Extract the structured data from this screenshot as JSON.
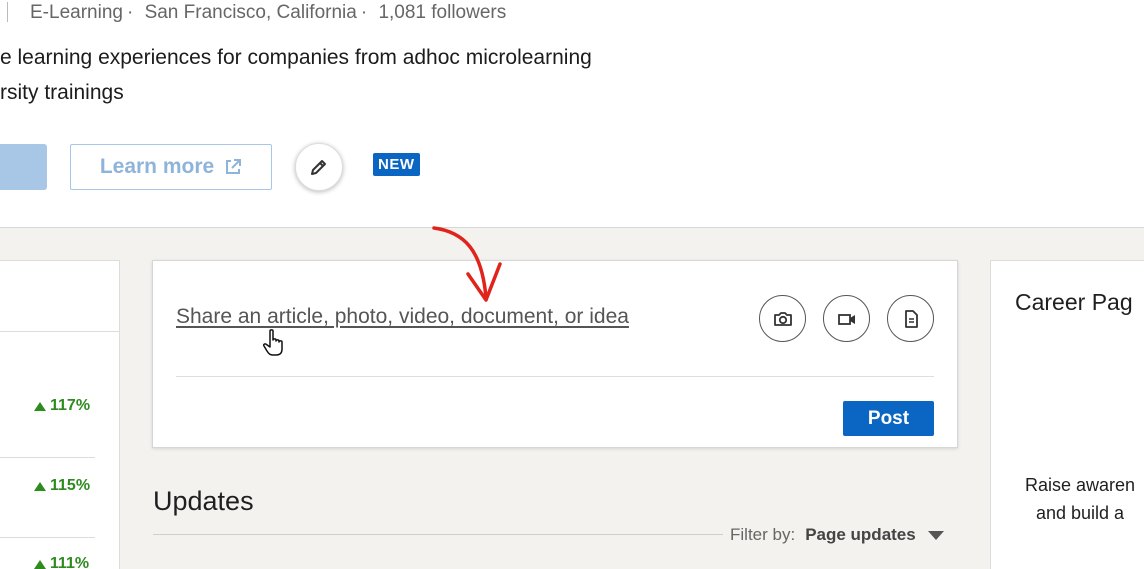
{
  "top_card": {
    "industry": "E-Learning",
    "location": "San Francisco, California",
    "followers": "1,081 followers",
    "separator": "·",
    "description_line1": "e learning experiences for companies from adhoc microlearning",
    "description_line2": "rsity trainings",
    "learn_more_label": "Learn more",
    "new_badge": "NEW"
  },
  "left_card": {
    "stats": [
      "117%",
      "115%",
      "111%"
    ]
  },
  "share_box": {
    "prompt": "Share an article, photo, video, document, or idea",
    "post_label": "Post",
    "media_icons": [
      "camera-icon",
      "video-icon",
      "document-icon"
    ]
  },
  "updates": {
    "title": "Updates",
    "filter_label": "Filter by:",
    "filter_value": "Page updates"
  },
  "right_card": {
    "title": "Career Pag",
    "body_line1": "Raise awaren",
    "body_line2": "and build a"
  },
  "colors": {
    "brand_blue": "#0a66c2",
    "positive_green": "#2e8b1e",
    "annotation_red": "#e0241b"
  }
}
